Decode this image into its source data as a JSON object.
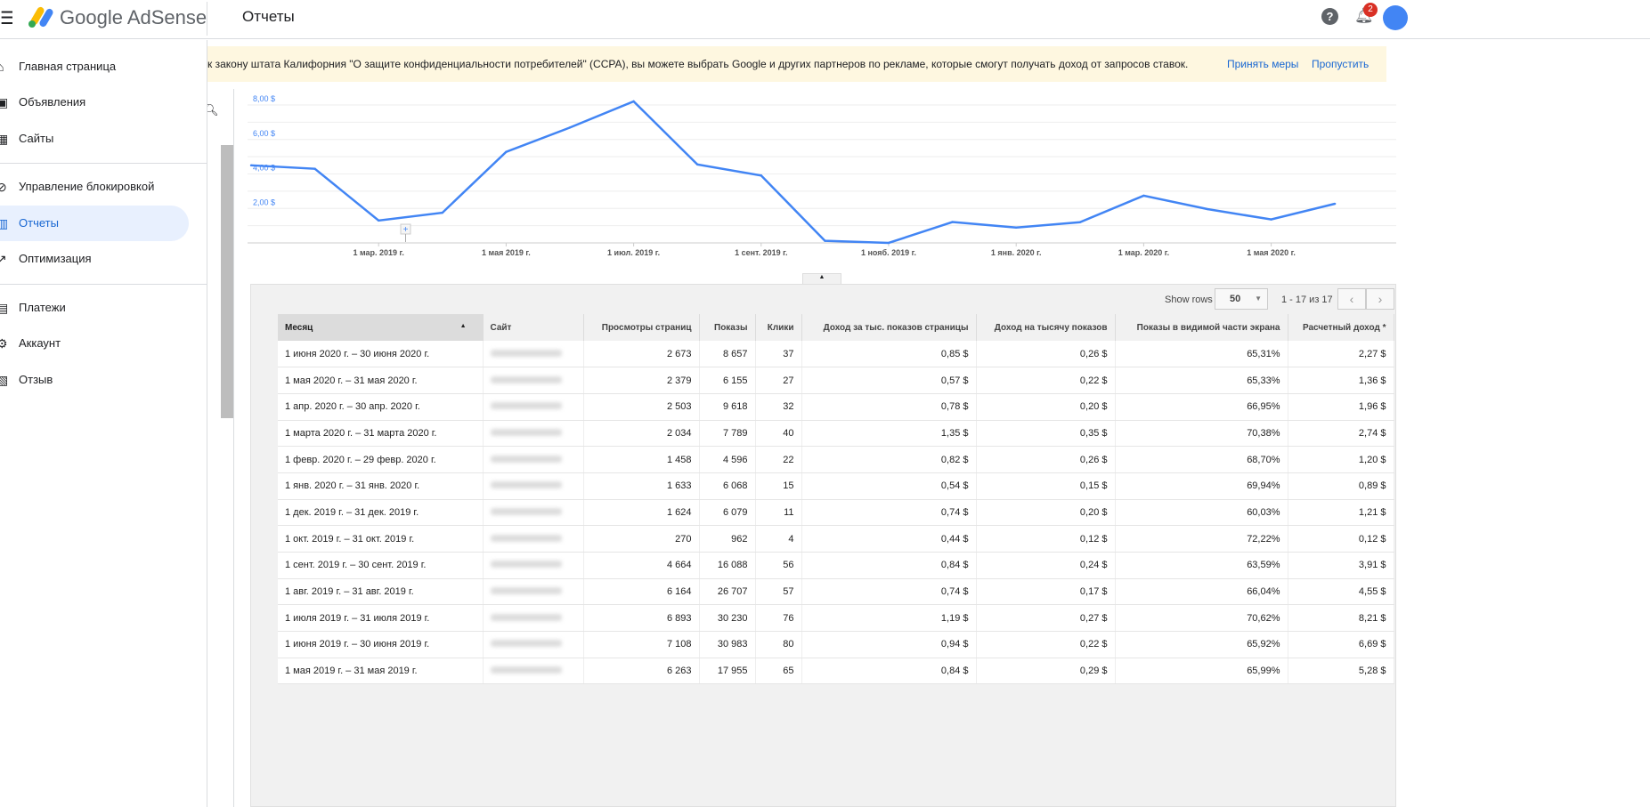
{
  "header": {
    "brand": "Google AdSense",
    "title": "Отчеты",
    "notif_count": "2",
    "help": "?"
  },
  "banner": {
    "text": "к закону штата Калифорния \"О защите конфиденциальности потребителей\" (CCPA), вы можете выбрать Google и других партнеров по рекламе, которые смогут получать доход от запросов ставок.",
    "action": "Принять меры",
    "skip": "Пропустить"
  },
  "sidebar": {
    "items": [
      {
        "label": "Главная страница",
        "icon": "home-icon"
      },
      {
        "label": "Объявления",
        "icon": "ads-icon"
      },
      {
        "label": "Сайты",
        "icon": "sites-icon"
      },
      {
        "label": "Управление блокировкой",
        "icon": "block-icon"
      },
      {
        "label": "Отчеты",
        "icon": "reports-icon"
      },
      {
        "label": "Оптимизация",
        "icon": "trend-icon"
      },
      {
        "label": "Платежи",
        "icon": "payments-icon"
      },
      {
        "label": "Аккаунт",
        "icon": "gear-icon"
      },
      {
        "label": "Отзыв",
        "icon": "feedback-icon"
      }
    ]
  },
  "chart_data": {
    "type": "line",
    "ylabel": "",
    "ylim": [
      0,
      8
    ],
    "yticks": [
      "2,00 $",
      "4,00 $",
      "6,00 $",
      "8,00 $"
    ],
    "xticks": [
      "1 мар. 2019 г.",
      "1 мая 2019 г.",
      "1 июл. 2019 г.",
      "1 сент. 2019 г.",
      "1 нояб. 2019 г.",
      "1 янв. 2020 г.",
      "1 мар. 2020 г.",
      "1 мая 2020 г."
    ],
    "x": [
      "2019-01",
      "2019-02",
      "2019-03",
      "2019-04",
      "2019-05",
      "2019-06",
      "2019-07",
      "2019-08",
      "2019-09",
      "2019-10",
      "2019-11",
      "2019-12",
      "2020-01",
      "2020-02",
      "2020-03",
      "2020-04",
      "2020-05",
      "2020-06"
    ],
    "series": [
      {
        "name": "Расчетный доход",
        "color": "#4285f4",
        "values": [
          4.5,
          4.3,
          1.3,
          1.75,
          5.28,
          6.69,
          8.21,
          4.55,
          3.91,
          0.12,
          0.0,
          1.21,
          0.89,
          1.2,
          2.74,
          1.96,
          1.36,
          2.27
        ]
      }
    ]
  },
  "table": {
    "show_rows_label": "Show rows",
    "show_rows_value": "50",
    "range": "1 - 17 из 17",
    "columns": [
      "Месяц",
      "Сайт",
      "Просмотры страниц",
      "Показы",
      "Клики",
      "Доход за тыс. показов страницы",
      "Доход на тысячу показов",
      "Показы в видимой части экрана",
      "Расчетный доход *"
    ],
    "rows": [
      [
        "1 июня 2020 г. – 30 июня 2020 г.",
        "2 673",
        "8 657",
        "37",
        "0,85 $",
        "0,26 $",
        "65,31%",
        "2,27 $"
      ],
      [
        "1 мая 2020 г. – 31 мая 2020 г.",
        "2 379",
        "6 155",
        "27",
        "0,57 $",
        "0,22 $",
        "65,33%",
        "1,36 $"
      ],
      [
        "1 апр. 2020 г. – 30 апр. 2020 г.",
        "2 503",
        "9 618",
        "32",
        "0,78 $",
        "0,20 $",
        "66,95%",
        "1,96 $"
      ],
      [
        "1 марта 2020 г. – 31 марта 2020 г.",
        "2 034",
        "7 789",
        "40",
        "1,35 $",
        "0,35 $",
        "70,38%",
        "2,74 $"
      ],
      [
        "1 февр. 2020 г. – 29 февр. 2020 г.",
        "1 458",
        "4 596",
        "22",
        "0,82 $",
        "0,26 $",
        "68,70%",
        "1,20 $"
      ],
      [
        "1 янв. 2020 г. – 31 янв. 2020 г.",
        "1 633",
        "6 068",
        "15",
        "0,54 $",
        "0,15 $",
        "69,94%",
        "0,89 $"
      ],
      [
        "1 дек. 2019 г. – 31 дек. 2019 г.",
        "1 624",
        "6 079",
        "11",
        "0,74 $",
        "0,20 $",
        "60,03%",
        "1,21 $"
      ],
      [
        "1 окт. 2019 г. – 31 окт. 2019 г.",
        "270",
        "962",
        "4",
        "0,44 $",
        "0,12 $",
        "72,22%",
        "0,12 $"
      ],
      [
        "1 сент. 2019 г. – 30 сент. 2019 г.",
        "4 664",
        "16 088",
        "56",
        "0,84 $",
        "0,24 $",
        "63,59%",
        "3,91 $"
      ],
      [
        "1 авг. 2019 г. – 31 авг. 2019 г.",
        "6 164",
        "26 707",
        "57",
        "0,74 $",
        "0,17 $",
        "66,04%",
        "4,55 $"
      ],
      [
        "1 июля 2019 г. – 31 июля 2019 г.",
        "6 893",
        "30 230",
        "76",
        "1,19 $",
        "0,27 $",
        "70,62%",
        "8,21 $"
      ],
      [
        "1 июня 2019 г. – 30 июня 2019 г.",
        "7 108",
        "30 983",
        "80",
        "0,94 $",
        "0,22 $",
        "65,92%",
        "6,69 $"
      ],
      [
        "1 мая 2019 г. – 31 мая 2019 г.",
        "6 263",
        "17 955",
        "65",
        "0,84 $",
        "0,29 $",
        "65,99%",
        "5,28 $"
      ]
    ]
  }
}
